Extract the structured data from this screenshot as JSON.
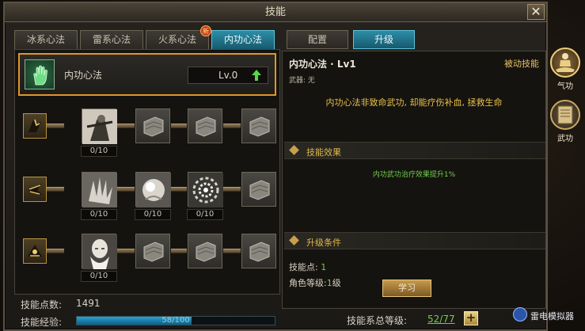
{
  "window": {
    "title": "技能",
    "close": "✕"
  },
  "left_tabs": [
    {
      "label": "冰系心法",
      "active": false
    },
    {
      "label": "雷系心法",
      "active": false
    },
    {
      "label": "火系心法",
      "active": false,
      "badge": "新"
    },
    {
      "label": "内功心法",
      "active": true
    }
  ],
  "selected_skill": {
    "name": "内功心法",
    "level": "Lv.0"
  },
  "skill_rows": [
    {
      "nodes": [
        {
          "count": "0/10",
          "state": "unlocked"
        },
        {
          "state": "locked"
        },
        {
          "state": "locked"
        },
        {
          "state": "locked"
        }
      ]
    },
    {
      "nodes": [
        {
          "count": "0/10",
          "state": "unlocked"
        },
        {
          "count": "0/10",
          "state": "unlocked"
        },
        {
          "count": "0/10",
          "state": "unlocked"
        },
        {
          "state": "locked"
        }
      ]
    },
    {
      "nodes": [
        {
          "count": "0/10",
          "state": "unlocked"
        },
        {
          "state": "locked"
        },
        {
          "state": "locked"
        },
        {
          "state": "locked"
        }
      ]
    }
  ],
  "stats": {
    "points_label": "技能点数:",
    "points_value": "1491",
    "exp_label": "技能经验:",
    "exp_text": "58/100",
    "exp_fraction": 0.58
  },
  "right_tabs": [
    {
      "label": "配置",
      "active": false
    },
    {
      "label": "升级",
      "active": true
    }
  ],
  "detail": {
    "title": "内功心法 · Lv1",
    "type": "被动技能",
    "weapon": "武器: 无",
    "description": "内功心法非致命武功, 却能疗伤补血, 拯救生命",
    "effect_header": "技能效果",
    "effect_text": "内功武功治疗效果提升1%",
    "req_header": "升级条件",
    "req_points_label": "技能点:",
    "req_points_value": "1",
    "req_level_label": "角色等级:",
    "req_level_value": "1",
    "req_level_unit": "级",
    "learn_button": "学习"
  },
  "total": {
    "label": "技能系总等级:",
    "value": "52/77",
    "plus": "+"
  },
  "side_buttons": [
    {
      "label": "气功",
      "active": true
    },
    {
      "label": "武功",
      "active": false
    }
  ],
  "watermark": "雷电模拟器",
  "colors": {
    "accent_teal": "#2b8ea8",
    "selected_border": "#e0962a",
    "green_text": "#6fcf4c",
    "gold_text": "#e8c24a"
  }
}
